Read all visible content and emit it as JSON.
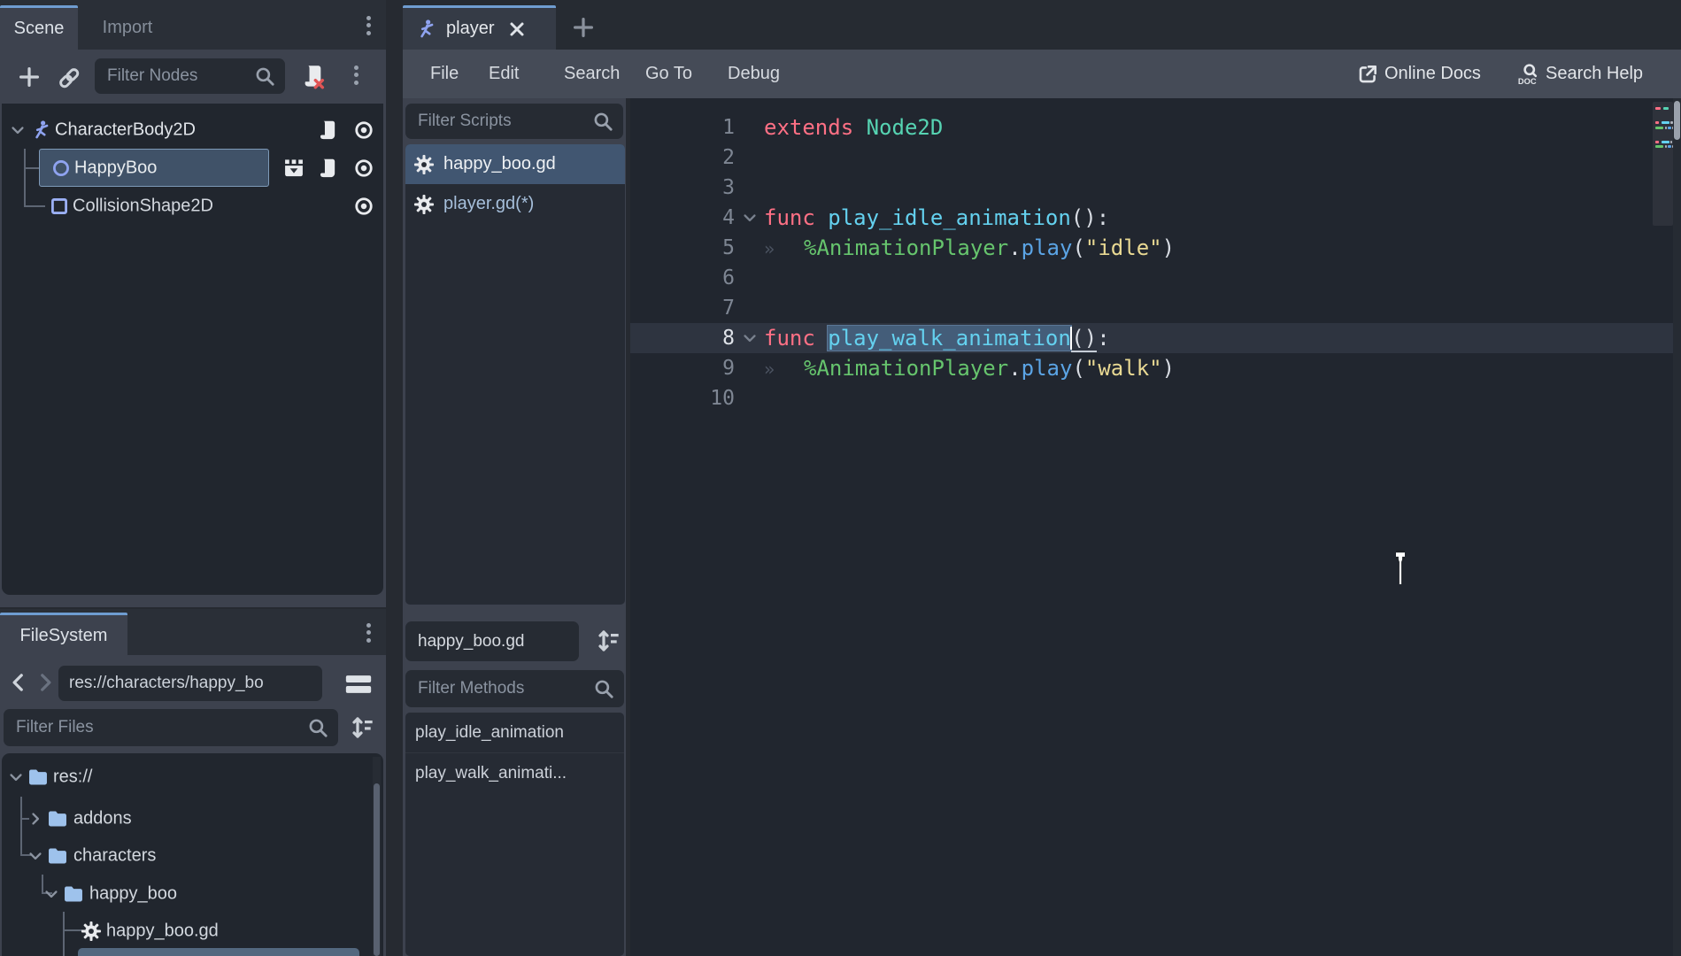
{
  "colors": {
    "accent_tab": "#6f9dd1",
    "selection_blue": "#415671",
    "node_icon_blue": "#8fa3f0",
    "folder_blue": "#9ec2ec",
    "clear_script_x_red": "#e05555",
    "syntax": {
      "keyword": "#ff7085",
      "base_type": "#56d3b2",
      "function_definition": "#64d1ef",
      "node_reference": "#66c46d",
      "function_call": "#5ba4e5",
      "string": "#e9d993",
      "plain": "#d8dce3"
    }
  },
  "scene_panel": {
    "tabs": [
      {
        "label": "Scene"
      },
      {
        "label": "Import"
      }
    ],
    "filter_placeholder": "Filter Nodes",
    "tree": [
      {
        "name": "CharacterBody2D",
        "icon": "character-body2d",
        "expanded": true,
        "selected": false,
        "badges": [
          "script",
          "visibility"
        ]
      },
      {
        "name": "HappyBoo",
        "icon": "node-circle",
        "expanded": false,
        "selected": true,
        "badges": [
          "scene",
          "script",
          "visibility"
        ]
      },
      {
        "name": "CollisionShape2D",
        "icon": "collision-square",
        "expanded": false,
        "selected": false,
        "badges": [
          "visibility"
        ]
      }
    ]
  },
  "filesystem_panel": {
    "tab_label": "FileSystem",
    "path": "res://characters/happy_bo",
    "filter_placeholder": "Filter Files",
    "tree": [
      {
        "name": "res://",
        "type": "folder",
        "state": "expanded"
      },
      {
        "name": "addons",
        "type": "folder",
        "state": "collapsed"
      },
      {
        "name": "characters",
        "type": "folder",
        "state": "expanded"
      },
      {
        "name": "happy_boo",
        "type": "folder",
        "state": "expanded"
      },
      {
        "name": "happy_boo.gd",
        "type": "script",
        "state": "leaf"
      }
    ]
  },
  "script_editor": {
    "scene_tabs": [
      {
        "label": "player",
        "active": true
      }
    ],
    "menus": [
      "File",
      "Edit",
      "Search",
      "Go To",
      "Debug"
    ],
    "help": {
      "online_docs": "Online Docs",
      "search_help": "Search Help"
    },
    "scripts_filter_placeholder": "Filter Scripts",
    "scripts": [
      {
        "name": "happy_boo.gd",
        "selected": true
      },
      {
        "name": "player.gd(*)",
        "selected": false
      }
    ],
    "methods_header": "happy_boo.gd",
    "methods_filter_placeholder": "Filter Methods",
    "methods": [
      "play_idle_animation",
      "play_walk_animati..."
    ],
    "code": {
      "lines": [
        {
          "n": 1,
          "tokens": [
            {
              "t": "extends",
              "c": "kw"
            },
            {
              "t": " "
            },
            {
              "t": "Node2D",
              "c": "type"
            }
          ]
        },
        {
          "n": 2,
          "tokens": []
        },
        {
          "n": 3,
          "tokens": []
        },
        {
          "n": 4,
          "fold": true,
          "tokens": [
            {
              "t": "func",
              "c": "kw"
            },
            {
              "t": " "
            },
            {
              "t": "play_idle_animation",
              "c": "fn"
            },
            {
              "t": "():"
            }
          ]
        },
        {
          "n": 5,
          "indent": true,
          "tokens": [
            {
              "t": "%AnimationPlayer",
              "c": "node"
            },
            {
              "t": "."
            },
            {
              "t": "play",
              "c": "call"
            },
            {
              "t": "("
            },
            {
              "t": "\"idle\"",
              "c": "str"
            },
            {
              "t": ")"
            }
          ]
        },
        {
          "n": 6,
          "tokens": []
        },
        {
          "n": 7,
          "tokens": []
        },
        {
          "n": 8,
          "fold": true,
          "current": true,
          "tokens": [
            {
              "t": "func",
              "c": "kw"
            },
            {
              "t": " "
            },
            {
              "t": "play_walk_animation",
              "c": "fn",
              "sel": true,
              "caretAfter": true
            },
            {
              "t": "()",
              "u": true
            },
            {
              "t": ":"
            }
          ]
        },
        {
          "n": 9,
          "indent": true,
          "tokens": [
            {
              "t": "%AnimationPlayer",
              "c": "node"
            },
            {
              "t": "."
            },
            {
              "t": "play",
              "c": "call"
            },
            {
              "t": "("
            },
            {
              "t": "\"walk\"",
              "c": "str"
            },
            {
              "t": ")"
            }
          ]
        },
        {
          "n": 10,
          "tokens": []
        }
      ]
    }
  }
}
